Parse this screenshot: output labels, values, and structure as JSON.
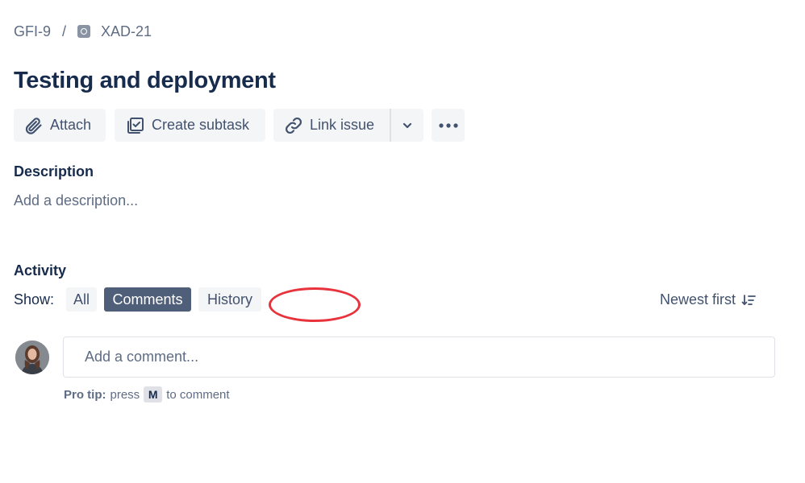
{
  "breadcrumb": {
    "parent": "GFI-9",
    "separator": "/",
    "current": "XAD-21"
  },
  "issue": {
    "title": "Testing and deployment"
  },
  "toolbar": {
    "attach_label": "Attach",
    "create_subtask_label": "Create subtask",
    "link_issue_label": "Link issue"
  },
  "description": {
    "heading": "Description",
    "placeholder": "Add a description..."
  },
  "activity": {
    "heading": "Activity",
    "show_label": "Show:",
    "filters": [
      {
        "label": "All",
        "selected": false
      },
      {
        "label": "Comments",
        "selected": true
      },
      {
        "label": "History",
        "selected": false
      }
    ],
    "sort_label": "Newest first"
  },
  "comment": {
    "placeholder": "Add a comment...",
    "pro_tip_label": "Pro tip:",
    "pro_tip_press": "press",
    "pro_tip_key": "M",
    "pro_tip_suffix": "to comment"
  },
  "colors": {
    "primary_text": "#172B4D",
    "secondary_text": "#5E6C84",
    "button_bg": "#F4F5F7",
    "selected_filter_bg": "#505F79",
    "annotation_red": "#E8333C"
  },
  "icons": {
    "crumb": "issue-type-icon",
    "attach": "paperclip-icon",
    "subtask": "subtask-checkbox-icon",
    "link": "link-icon",
    "dropdown": "chevron-down-icon",
    "more": "more-dots-icon",
    "sort": "sort-descending-icon"
  }
}
